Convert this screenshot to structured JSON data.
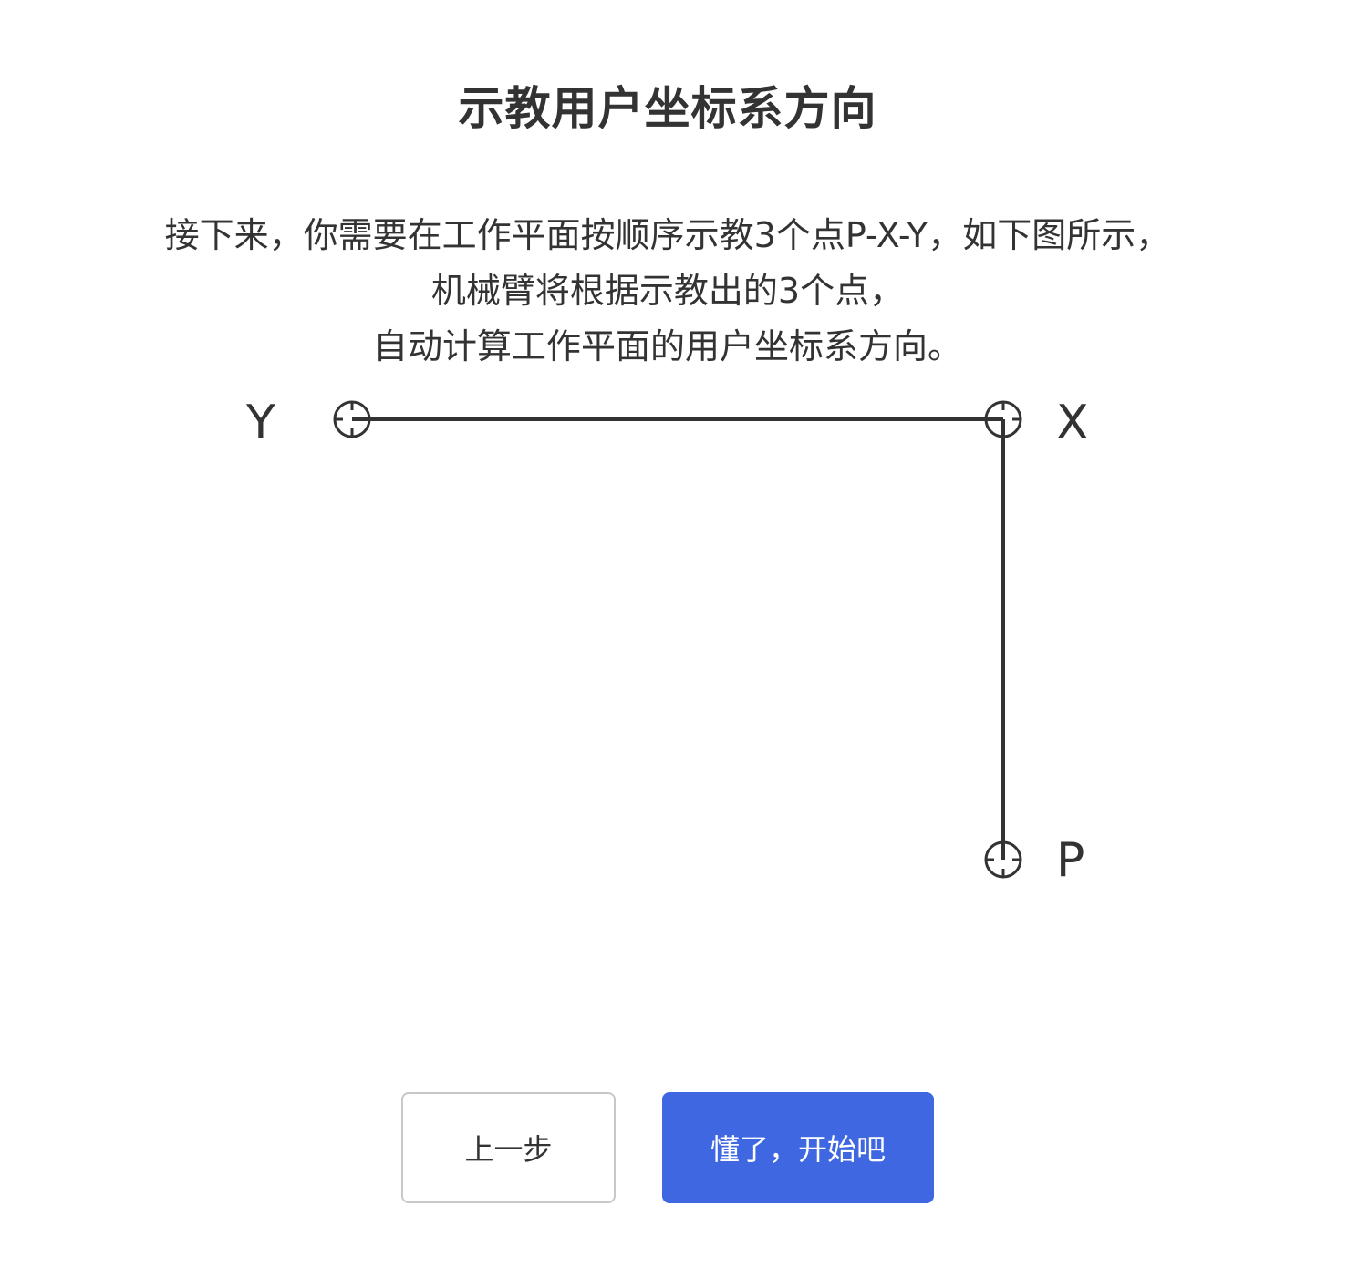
{
  "dialog": {
    "title": "示教用户坐标系方向",
    "description_lines": [
      "接下来，你需要在工作平面按顺序示教3个点P-X-Y，如下图所示，",
      "机械臂将根据示教出的3个点，",
      "自动计算工作平面的用户坐标系方向。"
    ]
  },
  "diagram": {
    "points": {
      "y_label": "Y",
      "x_label": "X",
      "p_label": "P"
    },
    "icon": "crosshair-target-icon",
    "line_color": "#333333"
  },
  "buttons": {
    "prev_label": "上一步",
    "start_label": "懂了，开始吧",
    "start_color": "#3f67e2"
  }
}
